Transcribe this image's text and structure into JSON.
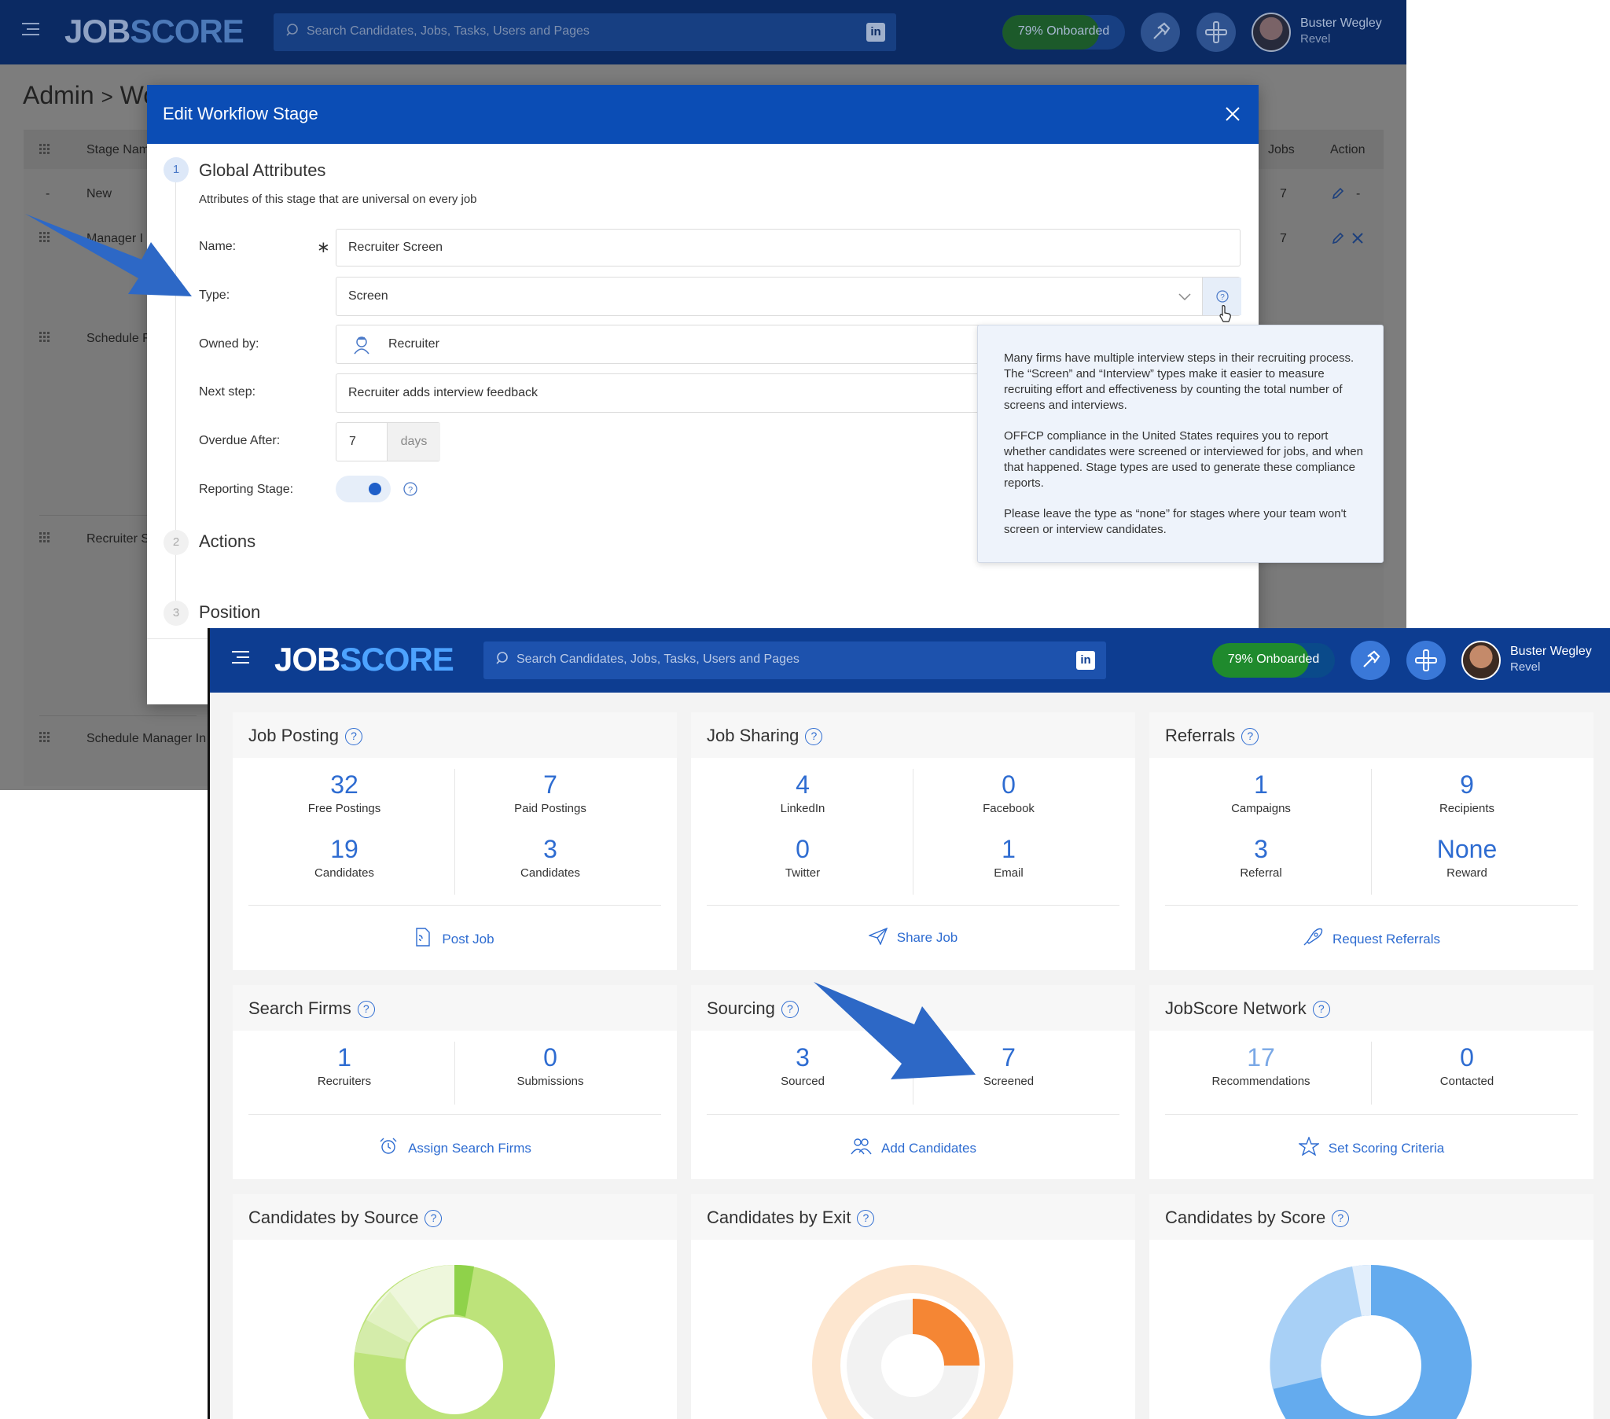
{
  "background_app": {
    "logo": {
      "job": "JOB",
      "score": "SCORE"
    },
    "search_placeholder": "Search Candidates, Jobs, Tasks, Users and Pages",
    "linkedin": "in",
    "onboarded": {
      "label": "79% Onboarded",
      "progress": 0.79
    },
    "user": {
      "name": "Buster Wegley",
      "org": "Revel"
    },
    "breadcrumb": {
      "root": "Admin",
      "sep": ">",
      "current": "Wo"
    },
    "table": {
      "headers": {
        "stage_name": "Stage Nam",
        "jobs": "Jobs",
        "action": "Action"
      },
      "rows": [
        {
          "dash": "-",
          "name": "New",
          "jobs": "7",
          "action_extra": "-"
        },
        {
          "name": "Manager I",
          "jobs": "7"
        },
        {
          "name": "Schedule F"
        },
        {
          "name": "Recruiter S"
        },
        {
          "name": "Schedule Manager In"
        }
      ]
    }
  },
  "modal": {
    "title": "Edit Workflow Stage",
    "steps": [
      {
        "num": "1",
        "title": "Global Attributes",
        "desc": "Attributes of this stage that are universal on every job"
      },
      {
        "num": "2",
        "title": "Actions"
      },
      {
        "num": "3",
        "title": "Position"
      }
    ],
    "fields": {
      "name_label": "Name:",
      "required_mark": "∗",
      "name_value": "Recruiter Screen",
      "type_label": "Type:",
      "type_value": "Screen",
      "owned_label": "Owned by:",
      "owned_value": "Recruiter",
      "next_label": "Next step:",
      "next_value": "Recruiter adds interview feedback",
      "overdue_label": "Overdue After:",
      "overdue_value": "7",
      "overdue_unit": "days",
      "reporting_label": "Reporting Stage:",
      "reporting_on": true
    },
    "tooltip": {
      "p1": "Many firms have multiple interview steps in their recruiting process. The “Screen” and “Interview” types make it easier to measure recruiting effort and effectiveness by counting the total number of screens and interviews.",
      "p2": "OFFCP compliance in the United States requires you to report whether candidates were screened or interviewed for jobs, and when that happened. Stage types are used to generate these compliance reports.",
      "p3": "Please leave the type as “none” for stages where your team won't screen or interview candidates."
    }
  },
  "dashboard": {
    "logo": {
      "job": "JOB",
      "score": "SCORE"
    },
    "search_placeholder": "Search Candidates, Jobs, Tasks, Users and Pages",
    "linkedin": "in",
    "onboarded": {
      "label": "79% Onboarded",
      "progress": 0.79
    },
    "user": {
      "name": "Buster Wegley",
      "org": "Revel"
    },
    "help": "?",
    "cards": {
      "job_posting": {
        "title": "Job Posting",
        "stats": [
          {
            "num": "32",
            "label": "Free Postings"
          },
          {
            "num": "7",
            "label": "Paid Postings"
          },
          {
            "num": "19",
            "label": "Candidates"
          },
          {
            "num": "3",
            "label": "Candidates"
          }
        ],
        "action": "Post Job"
      },
      "job_sharing": {
        "title": "Job Sharing",
        "stats": [
          {
            "num": "4",
            "label": "LinkedIn"
          },
          {
            "num": "0",
            "label": "Facebook"
          },
          {
            "num": "0",
            "label": "Twitter"
          },
          {
            "num": "1",
            "label": "Email"
          }
        ],
        "action": "Share Job"
      },
      "referrals": {
        "title": "Referrals",
        "stats": [
          {
            "num": "1",
            "label": "Campaigns"
          },
          {
            "num": "9",
            "label": "Recipients"
          },
          {
            "num": "3",
            "label": "Referral"
          },
          {
            "num": "None",
            "label": "Reward"
          }
        ],
        "action": "Request Referrals"
      },
      "search_firms": {
        "title": "Search Firms",
        "stats": [
          {
            "num": "1",
            "label": "Recruiters"
          },
          {
            "num": "0",
            "label": "Submissions"
          }
        ],
        "action": "Assign Search Firms"
      },
      "sourcing": {
        "title": "Sourcing",
        "stats": [
          {
            "num": "3",
            "label": "Sourced"
          },
          {
            "num": "7",
            "label": "Screened"
          }
        ],
        "action": "Add Candidates"
      },
      "jobscore_network": {
        "title": "JobScore Network",
        "stats": [
          {
            "num": "17",
            "label": "Recommendations"
          },
          {
            "num": "0",
            "label": "Contacted"
          }
        ],
        "action": "Set Scoring Criteria"
      },
      "by_source": {
        "title": "Candidates by Source"
      },
      "by_exit": {
        "title": "Candidates by Exit"
      },
      "by_score": {
        "title": "Candidates by Score"
      }
    }
  },
  "colors": {
    "nav": "#0d3d91",
    "modal_header": "#0b4db5",
    "link": "#2e6cd1",
    "arrow": "#2d68c6",
    "onboarded": "#1f8a2d"
  }
}
